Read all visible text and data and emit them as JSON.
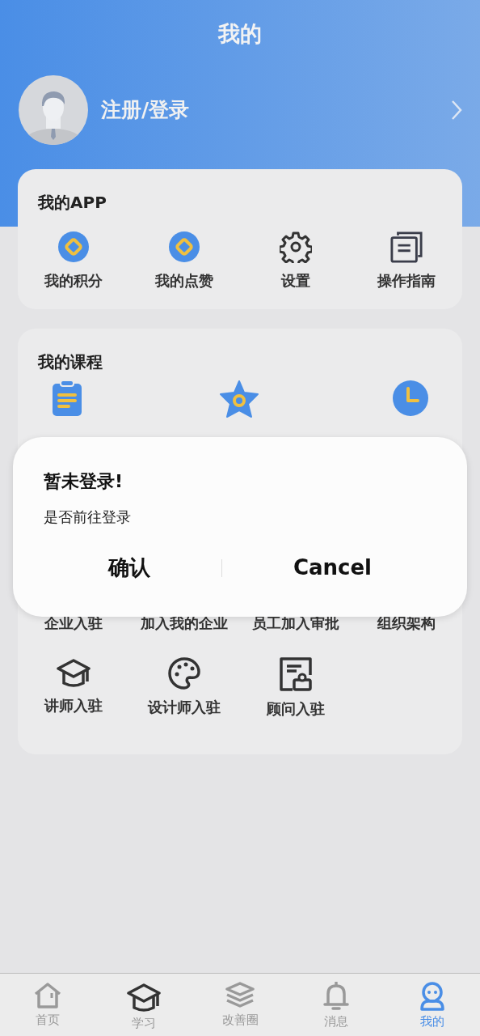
{
  "header": {
    "title": "我的"
  },
  "profile": {
    "login_text": "注册/登录"
  },
  "my_app": {
    "title": "我的APP",
    "items": [
      {
        "label": "我的积分",
        "kind": "coin"
      },
      {
        "label": "我的点赞",
        "kind": "coin"
      },
      {
        "label": "设置",
        "kind": "gear"
      },
      {
        "label": "操作指南",
        "kind": "docs"
      }
    ]
  },
  "my_courses": {
    "title": "我的课程",
    "items": [
      {
        "kind": "clipboard"
      },
      {
        "kind": "star"
      },
      {
        "kind": "clock"
      }
    ]
  },
  "enterprise": {
    "items": [
      {
        "label": "企业入驻",
        "kind": "hidden"
      },
      {
        "label": "加入我的企业",
        "kind": "hidden"
      },
      {
        "label": "员工加入审批",
        "kind": "hidden"
      },
      {
        "label": "组织架构",
        "kind": "hidden"
      },
      {
        "label": "讲师入驻",
        "kind": "cap"
      },
      {
        "label": "设计师入驻",
        "kind": "palette"
      },
      {
        "label": "顾问入驻",
        "kind": "consultant"
      }
    ]
  },
  "dialog": {
    "title": "暂未登录!",
    "message": "是否前往登录",
    "buttons": [
      "确认",
      "Cancel"
    ]
  },
  "tab_bar": [
    {
      "label": "首页",
      "kind": "home",
      "selected": false
    },
    {
      "label": "学习",
      "kind": "cap",
      "selected": false
    },
    {
      "label": "改善圈",
      "kind": "layers",
      "selected": false
    },
    {
      "label": "消息",
      "kind": "bell",
      "selected": false
    },
    {
      "label": "我的",
      "kind": "person",
      "selected": true
    }
  ]
}
